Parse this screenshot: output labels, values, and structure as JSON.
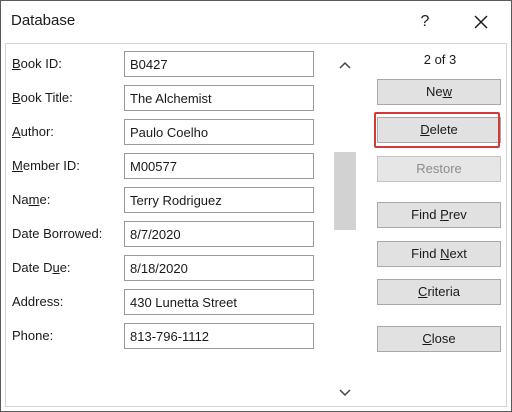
{
  "window": {
    "title": "Database",
    "help_label": "?"
  },
  "record_count": "2 of 3",
  "fields": [
    {
      "label_pre": "",
      "label_key": "B",
      "label_post": "ook ID:",
      "value": "B0427"
    },
    {
      "label_pre": "",
      "label_key": "B",
      "label_post": "ook Title:",
      "value": "The Alchemist"
    },
    {
      "label_pre": "",
      "label_key": "A",
      "label_post": "uthor:",
      "value": "Paulo Coelho"
    },
    {
      "label_pre": "",
      "label_key": "M",
      "label_post": "ember ID:",
      "value": "M00577"
    },
    {
      "label_pre": "Na",
      "label_key": "m",
      "label_post": "e:",
      "value": "Terry Rodriguez"
    },
    {
      "label_pre": "Date Borrowed:",
      "label_key": "",
      "label_post": "",
      "value": "8/7/2020"
    },
    {
      "label_pre": "Date D",
      "label_key": "u",
      "label_post": "e:",
      "value": "8/18/2020"
    },
    {
      "label_pre": "Address:",
      "label_key": "",
      "label_post": "",
      "value": "430 Lunetta Street"
    },
    {
      "label_pre": "Phone:",
      "label_key": "",
      "label_post": "",
      "value": "813-796-1112"
    }
  ],
  "buttons": {
    "new": {
      "pre": "Ne",
      "key": "w",
      "post": ""
    },
    "delete": {
      "pre": "",
      "key": "D",
      "post": "elete"
    },
    "restore": {
      "pre": "Restore",
      "key": "",
      "post": ""
    },
    "find_prev": {
      "pre": "Find ",
      "key": "P",
      "post": "rev"
    },
    "find_next": {
      "pre": "Find ",
      "key": "N",
      "post": "ext"
    },
    "criteria": {
      "pre": "",
      "key": "C",
      "post": "riteria"
    },
    "close": {
      "pre": "",
      "key": "C",
      "post": "lose"
    }
  },
  "colors": {
    "highlight": "#d23a3a",
    "button_face": "#e1e1e1",
    "scroll_thumb": "#d2d2d2"
  }
}
